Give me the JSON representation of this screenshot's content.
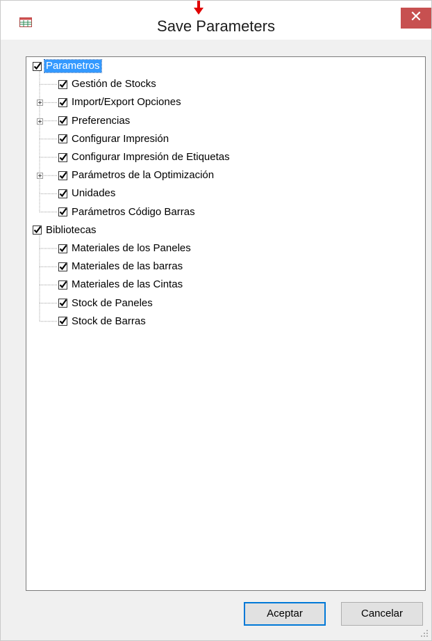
{
  "window": {
    "title": "Save Parameters",
    "close_glyph": "✕",
    "icon": "app-grid-icon"
  },
  "tree": {
    "roots": [
      {
        "label": "Parametros",
        "checked": true,
        "selected": true,
        "children": [
          {
            "label": "Gestión de Stocks",
            "checked": true,
            "expandable": false
          },
          {
            "label": "Import/Export Opciones",
            "checked": true,
            "expandable": true
          },
          {
            "label": "Preferencias",
            "checked": true,
            "expandable": true
          },
          {
            "label": "Configurar Impresión",
            "checked": true,
            "expandable": false
          },
          {
            "label": "Configurar Impresión de Etiquetas",
            "checked": true,
            "expandable": false
          },
          {
            "label": "Parámetros de la Optimización",
            "checked": true,
            "expandable": true
          },
          {
            "label": "Unidades",
            "checked": true,
            "expandable": false
          },
          {
            "label": "Parámetros Código Barras",
            "checked": true,
            "expandable": false
          }
        ]
      },
      {
        "label": "Bibliotecas",
        "checked": true,
        "selected": false,
        "children": [
          {
            "label": "Materiales de los Paneles",
            "checked": true,
            "expandable": false
          },
          {
            "label": "Materiales de las barras",
            "checked": true,
            "expandable": false
          },
          {
            "label": "Materiales de las Cintas",
            "checked": true,
            "expandable": false
          },
          {
            "label": "Stock de Paneles",
            "checked": true,
            "expandable": false
          },
          {
            "label": "Stock de Barras",
            "checked": true,
            "expandable": false
          }
        ]
      }
    ]
  },
  "buttons": {
    "accept_label": "Aceptar",
    "cancel_label": "Cancelar"
  },
  "colors": {
    "selection": "#3399ff",
    "close_button": "#c75050",
    "pointer_arrow": "#e00000"
  }
}
